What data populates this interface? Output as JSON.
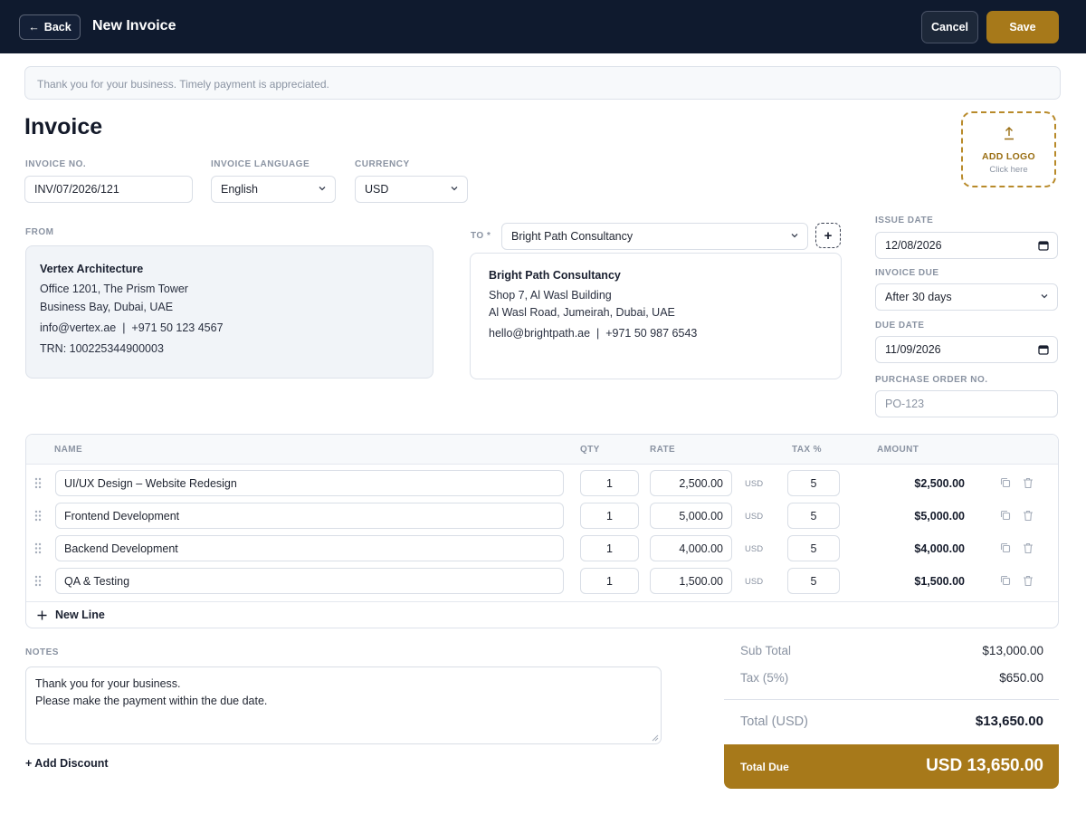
{
  "header": {
    "back_label": "Back",
    "title": "New Invoice",
    "cancel_label": "Cancel",
    "save_label": "Save"
  },
  "banner_text": "Thank you for your business. Timely payment is appreciated.",
  "page_title": "Invoice",
  "invoice_no": {
    "label": "INVOICE NO.",
    "value": "INV/07/2026/121"
  },
  "invoice_language": {
    "label": "INVOICE LANGUAGE",
    "value": "English"
  },
  "currency": {
    "label": "CURRENCY",
    "value": "USD"
  },
  "logo": {
    "title": "ADD LOGO",
    "subtitle": "Click here"
  },
  "from": {
    "label": "FROM",
    "name": "Vertex Architecture",
    "address1": "Office 1201, The Prism Tower",
    "address2": "Business Bay, Dubai, UAE",
    "contact": "info@vertex.ae  |  +971 50 123 4567",
    "trn": "TRN: 100225344900003"
  },
  "to": {
    "label": "TO",
    "required_mark": "*",
    "selected": "Bright Path Consultancy",
    "add_button": "+",
    "name": "Bright Path Consultancy",
    "address1": "Shop 7, Al Wasl Building",
    "address2": "Al Wasl Road, Jumeirah, Dubai, UAE",
    "contact": "hello@brightpath.ae  |  +971 50 987 6543"
  },
  "dates": {
    "issue_date_label": "ISSUE DATE",
    "issue_date": "12/08/2026",
    "invoice_due_label": "INVOICE DUE",
    "invoice_due": "After 30 days",
    "due_date_label": "DUE DATE",
    "due_date": "11/09/2026",
    "po_label": "PURCHASE ORDER NO.",
    "po_placeholder": "PO-123"
  },
  "table": {
    "headers": {
      "name": "NAME",
      "qty": "QTY",
      "rate": "RATE",
      "tax": "TAX %",
      "amount": "AMOUNT"
    },
    "rows": [
      {
        "name": "UI/UX Design – Website Redesign",
        "qty": "1",
        "rate": "2,500.00",
        "currency": "USD",
        "tax": "5",
        "amount": "$2,500.00"
      },
      {
        "name": "Frontend Development",
        "qty": "1",
        "rate": "5,000.00",
        "currency": "USD",
        "tax": "5",
        "amount": "$5,000.00"
      },
      {
        "name": "Backend Development",
        "qty": "1",
        "rate": "4,000.00",
        "currency": "USD",
        "tax": "5",
        "amount": "$4,000.00"
      },
      {
        "name": "QA & Testing",
        "qty": "1",
        "rate": "1,500.00",
        "currency": "USD",
        "tax": "5",
        "amount": "$1,500.00"
      }
    ],
    "new_line_label": "New Line"
  },
  "notes": {
    "label": "NOTES",
    "line1": "Thank you for your business.",
    "line2": "Please make the payment within the due date."
  },
  "add_discount_label": "+ Add Discount",
  "totals": {
    "subtotal_label": "Sub Total",
    "subtotal": "$13,000.00",
    "tax_label": "Tax (5%)",
    "tax": "$650.00",
    "total_label": "Total (USD)",
    "total": "$13,650.00",
    "total_due_label": "Total Due",
    "total_due": "USD 13,650.00"
  },
  "colors": {
    "topbar": "#0f1a2e",
    "accent_gold": "#a7791a",
    "muted_text": "#8a93a2"
  }
}
